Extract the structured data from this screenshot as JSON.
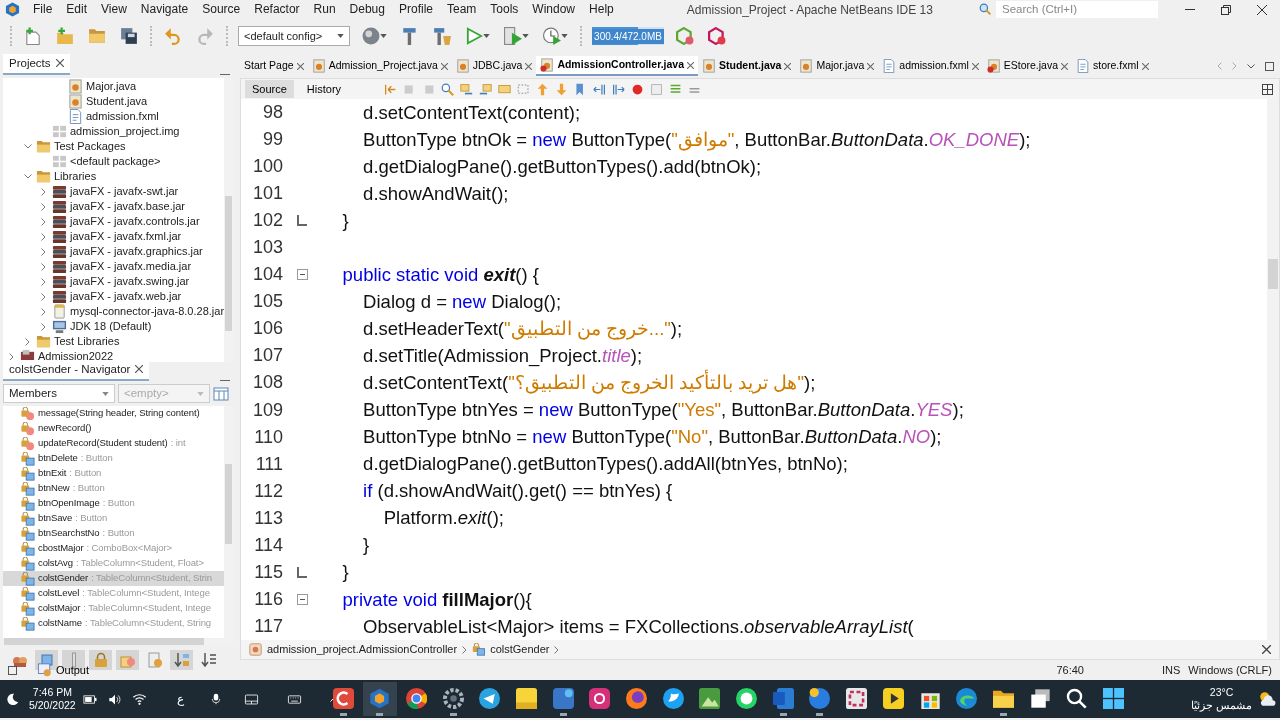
{
  "window": {
    "title": "Admission_Project - Apache NetBeans IDE 13"
  },
  "menu": [
    "File",
    "Edit",
    "View",
    "Navigate",
    "Source",
    "Refactor",
    "Run",
    "Debug",
    "Profile",
    "Team",
    "Tools",
    "Window",
    "Help"
  ],
  "search": {
    "placeholder": "Search (Ctrl+I)"
  },
  "toolbar": {
    "config": "<default config>",
    "memory": {
      "reading": "300.4/472.0MB",
      "level": 0.64
    }
  },
  "projects": {
    "title": "Projects",
    "tree": [
      {
        "children": [
          {
            "children": [
              {
                "children": [
                  {
                    "label": "Major.java",
                    "kind": "java"
                  },
                  {
                    "label": "Student.java",
                    "kind": "java"
                  },
                  {
                    "label": "admission.fxml",
                    "kind": "fxml"
                  }
                ]
              },
              {
                "label": "admission_project.img",
                "kind": "package"
              }
            ]
          },
          {
            "label": "Test Packages",
            "kind": "folder",
            "expanded": true,
            "children": [
              {
                "label": "<default package>",
                "kind": "package"
              }
            ]
          },
          {
            "label": "Libraries",
            "kind": "folder",
            "expanded": true,
            "children": [
              {
                "label": "javaFX - javafx-swt.jar",
                "kind": "jar",
                "expanded": false
              },
              {
                "label": "javaFX - javafx.base.jar",
                "kind": "jar",
                "expanded": false
              },
              {
                "label": "javaFX - javafx.controls.jar",
                "kind": "jar",
                "expanded": false
              },
              {
                "label": "javaFX - javafx.fxml.jar",
                "kind": "jar",
                "expanded": false
              },
              {
                "label": "javaFX - javafx.graphics.jar",
                "kind": "jar",
                "expanded": false
              },
              {
                "label": "javaFX - javafx.media.jar",
                "kind": "jar",
                "expanded": false
              },
              {
                "label": "javaFX - javafx.swing.jar",
                "kind": "jar",
                "expanded": false
              },
              {
                "label": "javaFX - javafx.web.jar",
                "kind": "jar",
                "expanded": false
              },
              {
                "label": "mysql-connector-java-8.0.28.jar",
                "kind": "jarfile",
                "expanded": false
              },
              {
                "label": "JDK 18 (Default)",
                "kind": "jdk",
                "expanded": false
              }
            ]
          },
          {
            "label": "Test Libraries",
            "kind": "folder",
            "expanded": false
          }
        ]
      },
      {
        "label": "Admission2022",
        "kind": "project",
        "expanded": false
      }
    ]
  },
  "navigator": {
    "title": "colstGender - Navigator",
    "view": "Members",
    "filter": {
      "value": "<empty>",
      "disabled": true
    },
    "members": [
      {
        "kind": "method",
        "name": "message(String header, String content)",
        "selected": false
      },
      {
        "kind": "method",
        "name": "newRecord()",
        "selected": false
      },
      {
        "kind": "method",
        "name": "updateRecord(Student student)",
        "type": ": int",
        "selected": false
      },
      {
        "kind": "field",
        "name": "btnDelete",
        "type": ": Button",
        "selected": false
      },
      {
        "kind": "field",
        "name": "btnExit",
        "type": ": Button",
        "selected": false
      },
      {
        "kind": "field",
        "name": "btnNew",
        "type": ": Button",
        "selected": false
      },
      {
        "kind": "field",
        "name": "btnOpenImage",
        "type": ": Button",
        "selected": false
      },
      {
        "kind": "field",
        "name": "btnSave",
        "type": ": Button",
        "selected": false
      },
      {
        "kind": "field",
        "name": "btnSearchstNo",
        "type": ": Button",
        "selected": false
      },
      {
        "kind": "field",
        "name": "cbostMajor",
        "type": ": ComboBox<Major>",
        "selected": false
      },
      {
        "kind": "field",
        "name": "colstAvg",
        "type": ": TableColumn<Student, Float>",
        "selected": false
      },
      {
        "kind": "field",
        "name": "colstGender",
        "type": ": TableColumn<Student, Strin",
        "selected": true
      },
      {
        "kind": "field",
        "name": "colstLevel",
        "type": ": TableColumn<Student, Intege",
        "selected": false
      },
      {
        "kind": "field",
        "name": "colstMajor",
        "type": ": TableColumn<Student, Intege",
        "selected": false
      },
      {
        "kind": "field",
        "name": "colstName",
        "type": ": TableColumn<Student, String",
        "selected": false
      }
    ],
    "filters": [
      {
        "pressed": false
      },
      {
        "pressed": true
      },
      {
        "pressed": true
      },
      {
        "pressed": true
      },
      {
        "pressed": true
      },
      {
        "pressed": false
      },
      {
        "pressed": true
      },
      {
        "pressed": false
      }
    ]
  },
  "editor": {
    "tabs": [
      {
        "label": "Start Page",
        "kind": "plain",
        "bold": false,
        "selected": false
      },
      {
        "label": "Admission_Project.java",
        "kind": "java",
        "bold": false,
        "selected": false
      },
      {
        "label": "JDBC.java",
        "kind": "java",
        "bold": false,
        "selected": false
      },
      {
        "label": "AdmissionController.java",
        "kind": "java_error",
        "bold": true,
        "selected": true
      },
      {
        "label": "Student.java",
        "kind": "java",
        "bold": true,
        "selected": false
      },
      {
        "label": "Major.java",
        "kind": "java",
        "bold": false,
        "selected": false
      },
      {
        "label": "admission.fxml",
        "kind": "fxml",
        "bold": false,
        "selected": false
      },
      {
        "label": "EStore.java",
        "kind": "java_error",
        "bold": false,
        "selected": false
      },
      {
        "label": "store.fxml",
        "kind": "fxml",
        "bold": false,
        "selected": false
      }
    ],
    "views": [
      {
        "label": "Source",
        "selected": true
      },
      {
        "label": "History",
        "selected": false
      }
    ],
    "lines": [
      {
        "number": "98",
        "fold_start": false,
        "fold_end": false,
        "tokens": [
          {
            "kind": "plain",
            "text": "        d.setContentText(content);"
          }
        ]
      },
      {
        "number": "99",
        "fold_start": false,
        "fold_end": false,
        "tokens": [
          {
            "kind": "plain",
            "text": "        ButtonType btnOk = "
          },
          {
            "kind": "keyword",
            "text": "new"
          },
          {
            "kind": "plain",
            "text": " ButtonType("
          },
          {
            "kind": "string",
            "text": "\"موافق\""
          },
          {
            "kind": "plain",
            "text": ", ButtonBar."
          },
          {
            "kind": "italic",
            "text": "ButtonData"
          },
          {
            "kind": "plain",
            "text": "."
          },
          {
            "kind": "static",
            "text": "OK_DONE"
          },
          {
            "kind": "plain",
            "text": ");"
          }
        ]
      },
      {
        "number": "100",
        "fold_start": false,
        "fold_end": false,
        "tokens": [
          {
            "kind": "plain",
            "text": "        d.getDialogPane().getButtonTypes().add(btnOk);"
          }
        ]
      },
      {
        "number": "101",
        "fold_start": false,
        "fold_end": false,
        "tokens": [
          {
            "kind": "plain",
            "text": "        d.showAndWait();"
          }
        ]
      },
      {
        "number": "102",
        "fold_start": false,
        "fold_end": true,
        "tokens": [
          {
            "kind": "plain",
            "text": "    }"
          }
        ]
      },
      {
        "number": "103",
        "fold_start": false,
        "fold_end": false
      },
      {
        "number": "104",
        "fold_start": true,
        "fold_end": false,
        "tokens": [
          {
            "kind": "keyword",
            "text": "    public static void "
          },
          {
            "kind": "bold_italic",
            "text": "exit"
          },
          {
            "kind": "plain",
            "text": "() {"
          }
        ]
      },
      {
        "number": "105",
        "fold_start": false,
        "fold_end": false,
        "tokens": [
          {
            "kind": "plain",
            "text": "        Dialog d = "
          },
          {
            "kind": "keyword",
            "text": "new"
          },
          {
            "kind": "plain",
            "text": " Dialog();"
          }
        ]
      },
      {
        "number": "106",
        "fold_start": false,
        "fold_end": false,
        "tokens": [
          {
            "kind": "plain",
            "text": "        d.setHeaderText("
          },
          {
            "kind": "string",
            "text": "\"خروج من التطبيق...\""
          },
          {
            "kind": "plain",
            "text": ");"
          }
        ]
      },
      {
        "number": "107",
        "fold_start": false,
        "fold_end": false,
        "tokens": [
          {
            "kind": "plain",
            "text": "        d.setTitle(Admission_Project."
          },
          {
            "kind": "static",
            "text": "title"
          },
          {
            "kind": "plain",
            "text": ");"
          }
        ]
      },
      {
        "number": "108",
        "fold_start": false,
        "fold_end": false,
        "tokens": [
          {
            "kind": "plain",
            "text": "        d.setContentText("
          },
          {
            "kind": "string",
            "text": "\"هل تريد بالتأكيد الخروج من التطبيق؟\""
          },
          {
            "kind": "plain",
            "text": ");"
          }
        ]
      },
      {
        "number": "109",
        "fold_start": false,
        "fold_end": false,
        "tokens": [
          {
            "kind": "plain",
            "text": "        ButtonType btnYes = "
          },
          {
            "kind": "keyword",
            "text": "new"
          },
          {
            "kind": "plain",
            "text": " ButtonType("
          },
          {
            "kind": "string",
            "text": "\"Yes\""
          },
          {
            "kind": "plain",
            "text": ", ButtonBar."
          },
          {
            "kind": "italic",
            "text": "ButtonData"
          },
          {
            "kind": "plain",
            "text": "."
          },
          {
            "kind": "static",
            "text": "YES"
          },
          {
            "kind": "plain",
            "text": ");"
          }
        ]
      },
      {
        "number": "110",
        "fold_start": false,
        "fold_end": false,
        "tokens": [
          {
            "kind": "plain",
            "text": "        ButtonType btnNo = "
          },
          {
            "kind": "keyword",
            "text": "new"
          },
          {
            "kind": "plain",
            "text": " ButtonType("
          },
          {
            "kind": "string",
            "text": "\"No\""
          },
          {
            "kind": "plain",
            "text": ", ButtonBar."
          },
          {
            "kind": "italic",
            "text": "ButtonData"
          },
          {
            "kind": "plain",
            "text": "."
          },
          {
            "kind": "static",
            "text": "NO"
          },
          {
            "kind": "plain",
            "text": ");"
          }
        ]
      },
      {
        "number": "111",
        "fold_start": false,
        "fold_end": false,
        "tokens": [
          {
            "kind": "plain",
            "text": "        d.getDialogPane().getButtonTypes().addAll(btnYes, btnNo);"
          }
        ]
      },
      {
        "number": "112",
        "fold_start": false,
        "fold_end": false,
        "tokens": [
          {
            "kind": "keyword",
            "text": "        if"
          },
          {
            "kind": "plain",
            "text": " (d.showAndWait().get() == btnYes) {"
          }
        ]
      },
      {
        "number": "113",
        "fold_start": false,
        "fold_end": false,
        "tokens": [
          {
            "kind": "plain",
            "text": "            Platform."
          },
          {
            "kind": "italic",
            "text": "exit"
          },
          {
            "kind": "plain",
            "text": "();"
          }
        ]
      },
      {
        "number": "114",
        "fold_start": false,
        "fold_end": false,
        "tokens": [
          {
            "kind": "plain",
            "text": "        }"
          }
        ]
      },
      {
        "number": "115",
        "fold_start": false,
        "fold_end": true,
        "tokens": [
          {
            "kind": "plain",
            "text": "    }"
          }
        ]
      },
      {
        "number": "116",
        "fold_start": true,
        "fold_end": false,
        "tokens": [
          {
            "kind": "keyword",
            "text": "    private void "
          },
          {
            "kind": "bold",
            "text": "fillMajor"
          },
          {
            "kind": "plain",
            "text": "(){"
          }
        ]
      },
      {
        "number": "117",
        "fold_start": false,
        "fold_end": false,
        "tokens": [
          {
            "kind": "plain",
            "text": "        ObservableList<Major> items = FXCollections."
          },
          {
            "kind": "italic",
            "text": "observableArrayList"
          },
          {
            "kind": "plain",
            "text": "("
          }
        ]
      }
    ],
    "breadcrumb": [
      "admission_project.AdmissionController",
      "colstGender"
    ]
  },
  "output": {
    "label": "Output"
  },
  "status_bar": {
    "position": "76:40",
    "mode": "INS",
    "line_endings": "Windows (CRLF)"
  },
  "taskbar": {
    "time": "7:46 PM",
    "date": "5/20/2022",
    "language": "ع",
    "apps": [
      {
        "running": true
      },
      {
        "running": true
      },
      {
        "running": false
      },
      {
        "running": true
      },
      {
        "running": false
      },
      {
        "running": false
      },
      {
        "running": true
      },
      {
        "running": false
      },
      {
        "running": false
      },
      {
        "running": false
      },
      {
        "running": false
      },
      {
        "running": false
      },
      {
        "running": true
      },
      {
        "running": true
      },
      {
        "running": false
      },
      {
        "running": false
      },
      {
        "running": false
      },
      {
        "running": false
      },
      {
        "running": true
      },
      {
        "running": false
      },
      {
        "running": false
      },
      {
        "running": false
      }
    ],
    "weather": {
      "temperature": "23°C",
      "condition": "مشمس جزئيًا"
    }
  }
}
